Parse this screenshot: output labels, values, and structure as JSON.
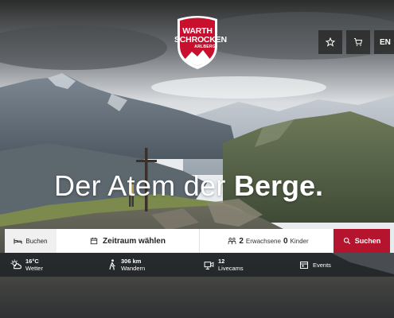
{
  "logo": {
    "line1": "WARTH",
    "line2": "SCHROCKEN",
    "line3": "ARLBERG"
  },
  "header": {
    "language": "EN"
  },
  "hero": {
    "headline_light": "Der Atem der ",
    "headline_bold": "Berge."
  },
  "booking": {
    "tab_label": "Buchen",
    "date_label": "Zeitraum wählen",
    "adults_count": "2",
    "adults_label": "Erwachsene",
    "children_count": "0",
    "children_label": "Kinder",
    "search_label": "Suchen"
  },
  "info": {
    "weather_value": "16°C",
    "weather_label": "Wetter",
    "hike_value": "306 km",
    "hike_label": "Wandern",
    "cams_value": "12",
    "cams_label": "Livecams",
    "events_label": "Events"
  },
  "colors": {
    "brand_red": "#b5142e",
    "dark_button": "#282828"
  }
}
